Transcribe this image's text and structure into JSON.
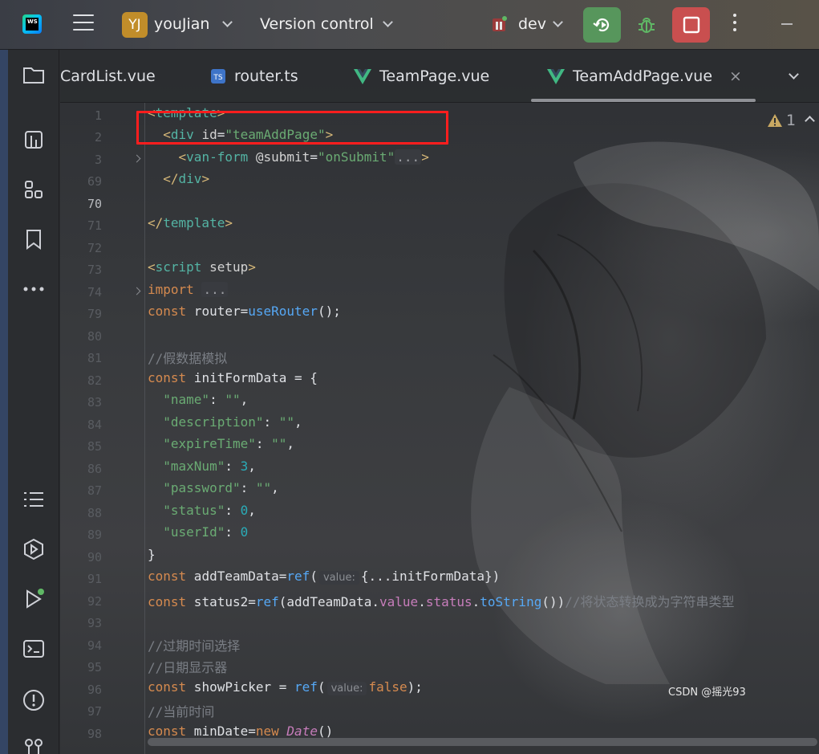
{
  "topbar": {
    "project_initials": "YJ",
    "project_name": "youJian",
    "vcs_label": "Version control",
    "branch": "dev",
    "colors": {
      "run": "#57965c",
      "stop": "#c94f4f",
      "avatar": "#c18d2a"
    }
  },
  "tabs": [
    {
      "label": "CardList.vue",
      "icon": "vue-icon"
    },
    {
      "label": "router.ts",
      "icon": "ts-icon",
      "badge": "TS"
    },
    {
      "label": "TeamPage.vue",
      "icon": "vue-icon"
    },
    {
      "label": "TeamAddPage.vue",
      "icon": "vue-icon",
      "active": true,
      "close": "×"
    }
  ],
  "editor": {
    "warning_count": "1",
    "line_numbers": [
      "1",
      "2",
      "3",
      "69",
      "70",
      "71",
      "72",
      "73",
      "74",
      "79",
      "80",
      "81",
      "82",
      "83",
      "84",
      "85",
      "86",
      "87",
      "88",
      "89",
      "90",
      "91",
      "92",
      "93",
      "94",
      "95",
      "96",
      "97",
      "98"
    ],
    "current_line": "70",
    "hints": {
      "value": "value:"
    },
    "comments": {
      "fake_data": "//假数据模拟",
      "to_string": "//将状态转换成为字符串类型",
      "expire_select": "//过期时间选择",
      "date_display": "//日期显示器",
      "current_time": "//当前时间"
    },
    "form_keys": [
      "\"name\"",
      "\"description\"",
      "\"expireTime\"",
      "\"maxNum\"",
      "\"password\"",
      "\"status\"",
      "\"userId\""
    ]
  },
  "watermark": "CSDN @摇光93"
}
